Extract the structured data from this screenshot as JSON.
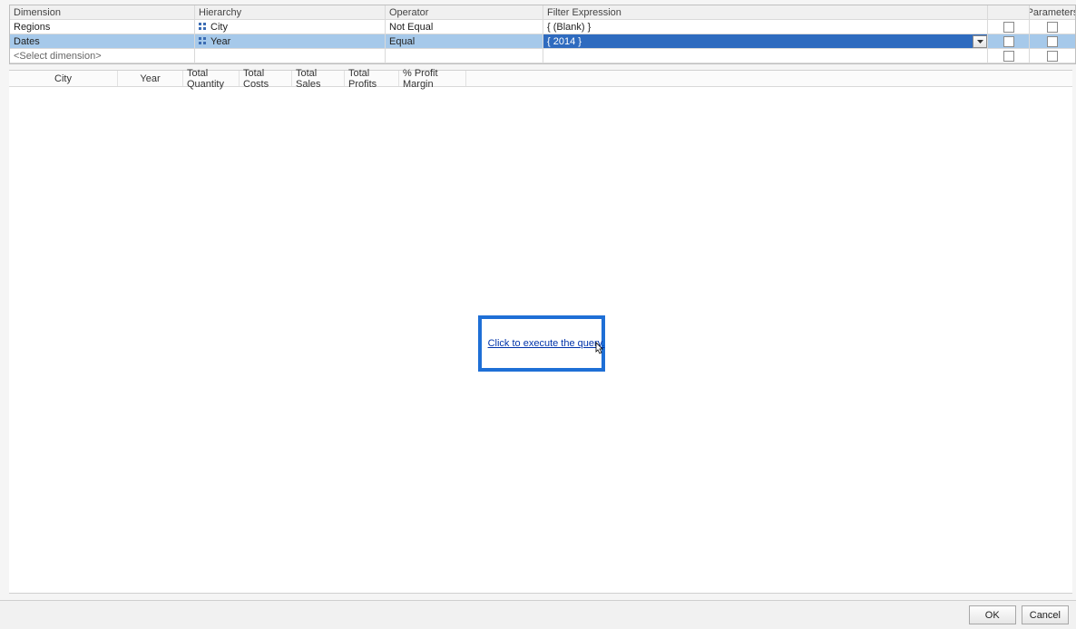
{
  "filterGrid": {
    "headers": {
      "dimension": "Dimension",
      "hierarchy": "Hierarchy",
      "operator": "Operator",
      "filterExpression": "Filter Expression",
      "parameters": "Parameters"
    },
    "rows": [
      {
        "dimension": "Regions",
        "hierarchy": "City",
        "operator": "Not Equal",
        "filterExpression": "{ (Blank) }"
      },
      {
        "dimension": "Dates",
        "hierarchy": "Year",
        "operator": "Equal",
        "filterExpression": "{ 2014 }"
      }
    ],
    "placeholder": "<Select dimension>"
  },
  "resultHeaders": [
    "City",
    "Year",
    "Total Quantity",
    "Total Costs",
    "Total Sales",
    "Total Profits",
    "% Profit Margin"
  ],
  "executeLink": "Click to execute the query.",
  "buttons": {
    "ok": "OK",
    "cancel": "Cancel"
  },
  "colors": {
    "selectRow": "#a6c9ea",
    "exprSelected": "#2e6bbf",
    "accent": "#1e6fd6"
  }
}
